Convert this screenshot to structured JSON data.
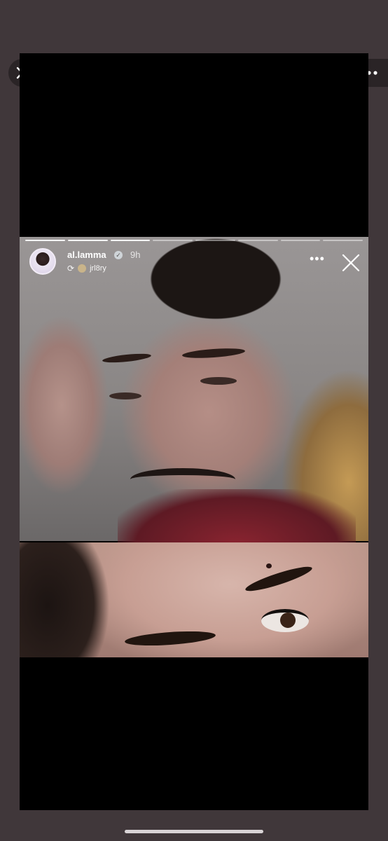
{
  "viewer": {
    "close_icon": "close-icon",
    "more_icon": "more-icon"
  },
  "story": {
    "progress_segments": 8,
    "progress_done": 3,
    "username": "al.lamma",
    "time": "9h",
    "reposted_from": "jrl8ry",
    "more_icon": "more-horizontal-icon",
    "close_icon": "close-icon"
  }
}
